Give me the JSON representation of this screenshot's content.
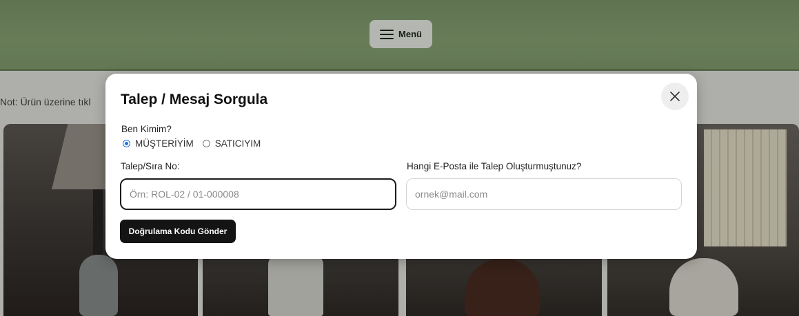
{
  "header": {
    "menu_label": "Menü",
    "menu_icon": "hamburger-icon"
  },
  "background": {
    "note_text": "Not: Ürün üzerine tıkl"
  },
  "modal": {
    "title": "Talep / Mesaj Sorgula",
    "close_icon": "close-icon",
    "role_question": "Ben Kimim?",
    "roles": [
      {
        "label": "MÜŞTERİYİM",
        "selected": true
      },
      {
        "label": "SATICIYIM",
        "selected": false
      }
    ],
    "ticket_field": {
      "label": "Talep/Sıra No:",
      "placeholder": "Örn: ROL-02 / 01-000008",
      "value": ""
    },
    "email_field": {
      "label": "Hangi E-Posta ile Talep Oluşturmuştunuz?",
      "placeholder": "ornek@mail.com",
      "value": ""
    },
    "submit_label": "Doğrulama Kodu Gönder"
  },
  "colors": {
    "header_green": "#86a072",
    "modal_bg": "#ffffff",
    "button_dark": "#141414",
    "radio_accent": "#1a73e8"
  }
}
